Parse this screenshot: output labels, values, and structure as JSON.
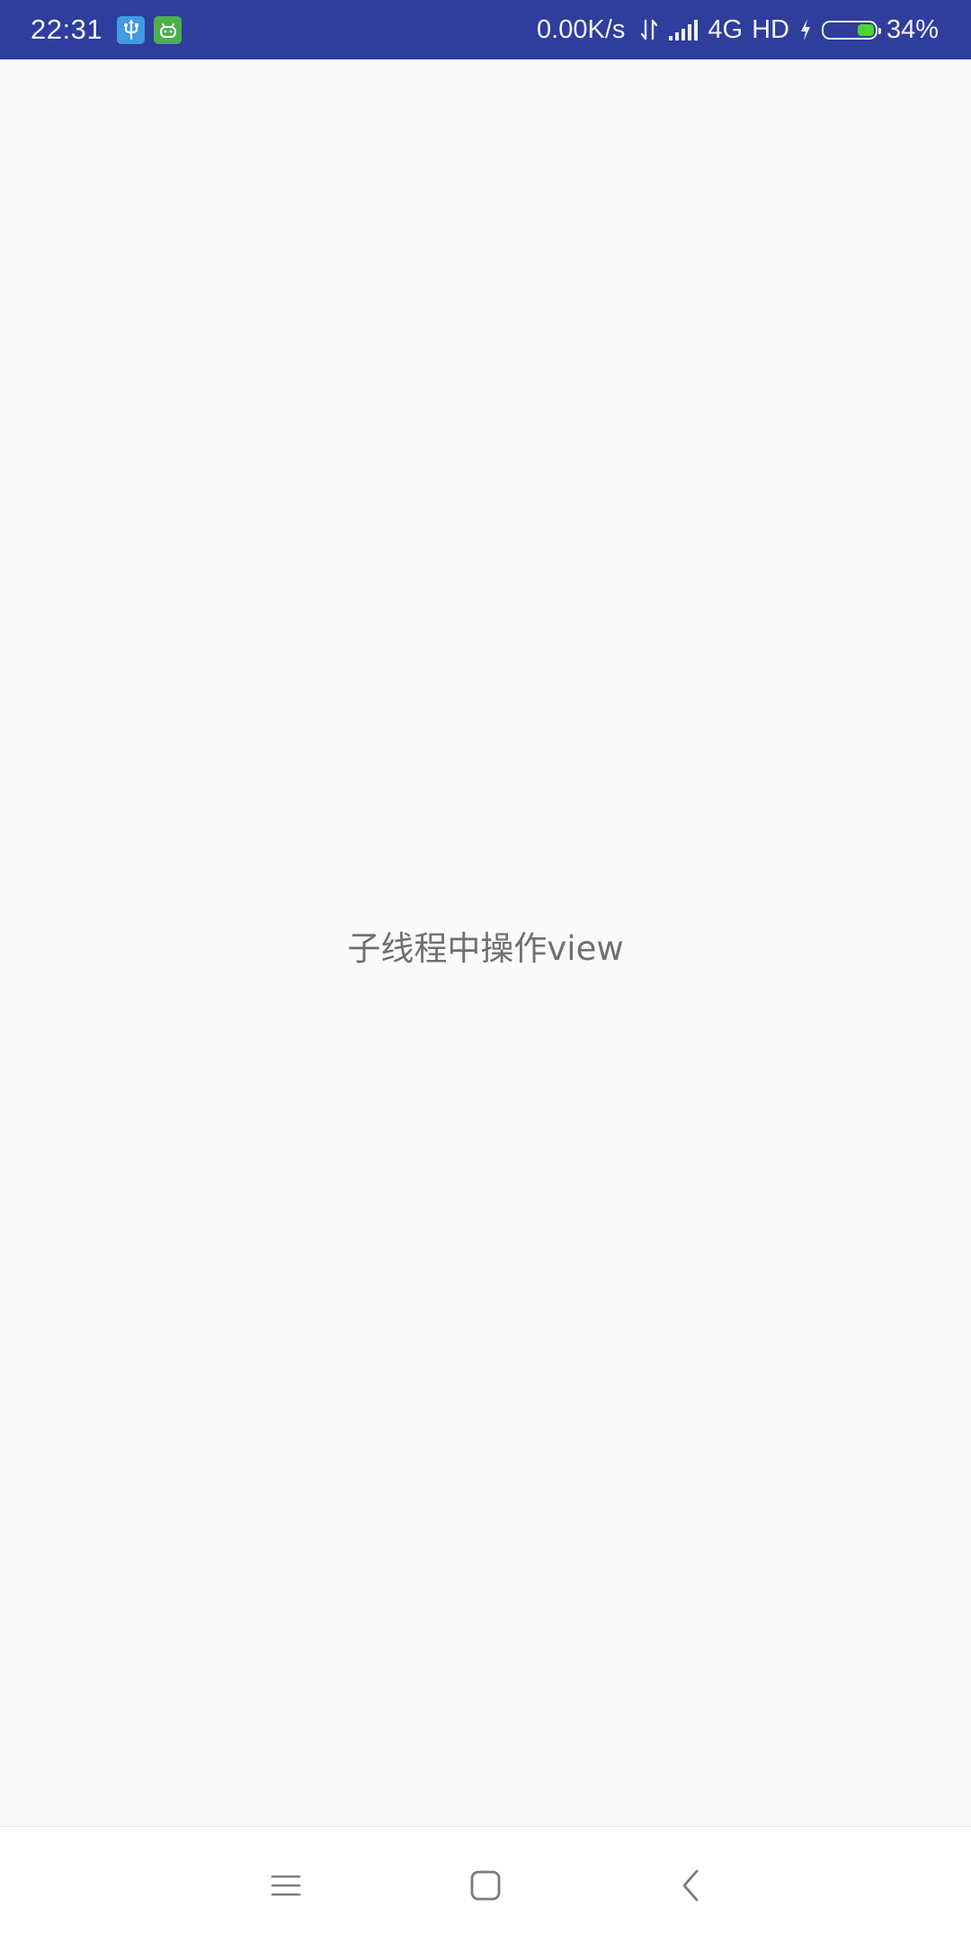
{
  "status_bar": {
    "time": "22:31",
    "left_icons": [
      "usb-icon",
      "app-notification-icon"
    ],
    "network_speed": "0.00K/s",
    "network_type": "4G",
    "hd_label": "HD",
    "battery_percent_label": "34%",
    "battery_level": 0.34,
    "colors": {
      "background": "#2f3d9c",
      "battery_fill": "#4cd137",
      "usb_icon_bg": "#3f9be3",
      "app_icon_bg": "#4caf50"
    }
  },
  "main": {
    "center_text": "子线程中操作view",
    "background": "#fafafa"
  },
  "nav_bar": {
    "buttons": [
      "menu-icon",
      "home-icon",
      "back-icon"
    ]
  }
}
